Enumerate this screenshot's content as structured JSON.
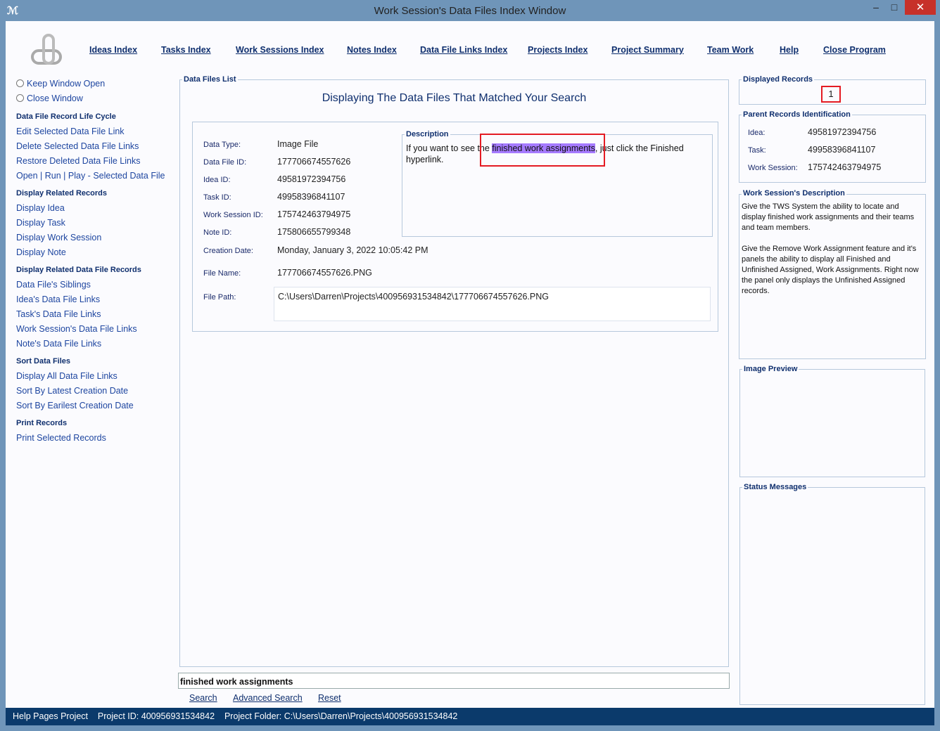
{
  "window": {
    "title": "Work Session's Data Files Index Window",
    "minimize": "–",
    "maximize": "□",
    "close": "✕"
  },
  "nav": [
    "Ideas Index",
    "Tasks Index",
    "Work Sessions Index",
    "Notes Index",
    "Data File Links Index",
    "Projects Index",
    "Project Summary",
    "Team Work",
    "Help",
    "Close Program"
  ],
  "sidebar": {
    "radios": [
      "Keep Window Open",
      "Close Window"
    ],
    "sections": [
      {
        "title": "Data File Record Life Cycle",
        "items": [
          "Edit Selected Data File Link",
          "Delete Selected Data File Links",
          "Restore Deleted Data File Links",
          "Open | Run | Play - Selected Data File"
        ]
      },
      {
        "title": "Display Related Records",
        "items": [
          "Display Idea",
          "Display Task",
          "Display Work Session",
          "Display Note"
        ]
      },
      {
        "title": "Display Related Data File Records",
        "items": [
          "Data File's Siblings",
          "Idea's Data File Links",
          "Task's Data File Links",
          "Work Session's Data File Links",
          "Note's Data File Links"
        ]
      },
      {
        "title": "Sort Data Files",
        "items": [
          "Display All Data File Links",
          "Sort By Latest Creation Date",
          "Sort By Earilest Creation Date"
        ]
      },
      {
        "title": "Print Records",
        "items": [
          "Print Selected Records"
        ]
      }
    ]
  },
  "main": {
    "legend": "Data Files List",
    "heading": "Displaying The Data Files That Matched Your Search",
    "record": {
      "fields": [
        {
          "label": "Data Type:",
          "value": "Image File"
        },
        {
          "label": "Data File ID:",
          "value": "177706674557626"
        },
        {
          "label": "Idea ID:",
          "value": "49581972394756"
        },
        {
          "label": "Task ID:",
          "value": "49958396841107"
        },
        {
          "label": "Work Session ID:",
          "value": "175742463794975"
        },
        {
          "label": "Note ID:",
          "value": "175806655799348"
        },
        {
          "label": "Creation Date:",
          "value": "Monday, January 3, 2022   10:05:42 PM"
        },
        {
          "label": "File Name:",
          "value": "177706674557626.PNG"
        },
        {
          "label": "File Path:",
          "value": "C:\\Users\\Darren\\Projects\\400956931534842\\177706674557626.PNG"
        }
      ],
      "description_legend": "Description",
      "description_pre": "If you want to see the ",
      "description_match": "finished work assignments",
      "description_post": ", just click the Finished hyperlink."
    },
    "search": {
      "value": "finished work assignments",
      "buttons": [
        "Search",
        "Advanced Search",
        "Reset"
      ]
    }
  },
  "right": {
    "displayed_legend": "Displayed Records",
    "displayed_count": "1",
    "parent_legend": "Parent Records Identification",
    "parents": [
      {
        "label": "Idea:",
        "value": "49581972394756"
      },
      {
        "label": "Task:",
        "value": "49958396841107"
      },
      {
        "label": "Work Session:",
        "value": "175742463794975"
      }
    ],
    "ws_desc_legend": "Work Session's Description",
    "ws_desc_p1": "Give the TWS System the ability to locate and display finished work assignments and their teams and team members.",
    "ws_desc_p2": "Give the Remove Work Assignment feature and it's panels the ability to display all Finished and Unfinished Assigned,  Work Assignments. Right now the panel only displays the Unfinished Assigned records.",
    "preview_legend": "Image Preview",
    "status_legend": "Status Messages"
  },
  "statusbar": {
    "project": "Help Pages Project",
    "project_id": "Project ID:  400956931534842",
    "folder": "Project Folder: C:\\Users\\Darren\\Projects\\400956931534842"
  },
  "colors": {
    "highlight": "#a57aff",
    "annotation": "#e41b23",
    "statusbar": "#0b3a6b",
    "frame": "#6f95b9"
  }
}
